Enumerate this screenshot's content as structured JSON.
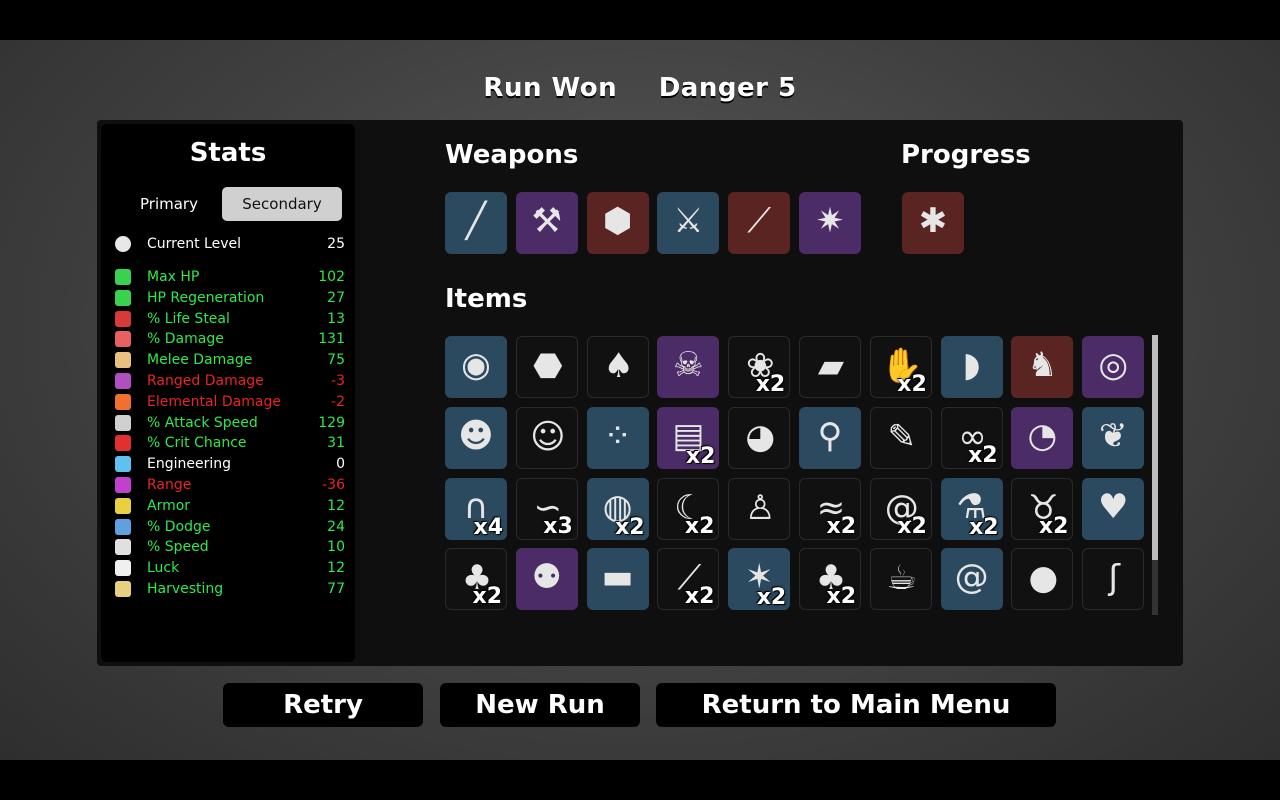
{
  "header": {
    "result": "Run Won",
    "danger": "Danger 5"
  },
  "stats": {
    "title": "Stats",
    "tabs": {
      "primary": "Primary",
      "secondary": "Secondary"
    },
    "current_level": {
      "label": "Current Level",
      "value": "25",
      "icon": "current-level-icon"
    },
    "rows": [
      {
        "label": "Max HP",
        "value": "102",
        "tone": "green",
        "icon": "heart-icon",
        "color": "#3ad14f"
      },
      {
        "label": "HP Regeneration",
        "value": "27",
        "tone": "green",
        "icon": "heart-plus-icon",
        "color": "#3ad14f"
      },
      {
        "label": "% Life Steal",
        "value": "13",
        "tone": "green",
        "icon": "fangs-icon",
        "color": "#d83a3a"
      },
      {
        "label": "% Damage",
        "value": "131",
        "tone": "green",
        "icon": "muscle-icon",
        "color": "#e86060"
      },
      {
        "label": "Melee Damage",
        "value": "75",
        "tone": "green",
        "icon": "sword-icon",
        "color": "#e8c080"
      },
      {
        "label": "Ranged Damage",
        "value": "-3",
        "tone": "red",
        "icon": "bow-icon",
        "color": "#b050c0"
      },
      {
        "label": "Elemental Damage",
        "value": "-2",
        "tone": "red",
        "icon": "fire-icon",
        "color": "#f07030"
      },
      {
        "label": "% Attack Speed",
        "value": "129",
        "tone": "green",
        "icon": "hourglass-icon",
        "color": "#d0d0d0"
      },
      {
        "label": "% Crit Chance",
        "value": "31",
        "tone": "green",
        "icon": "crit-icon",
        "color": "#e03030"
      },
      {
        "label": "Engineering",
        "value": "0",
        "tone": "white",
        "icon": "wrench-icon",
        "color": "#60c0f0"
      },
      {
        "label": "Range",
        "value": "-36",
        "tone": "red",
        "icon": "range-icon",
        "color": "#c040d0"
      },
      {
        "label": "Armor",
        "value": "12",
        "tone": "green",
        "icon": "shield-icon",
        "color": "#e8d040"
      },
      {
        "label": "% Dodge",
        "value": "24",
        "tone": "green",
        "icon": "dodge-icon",
        "color": "#60a0e0"
      },
      {
        "label": "% Speed",
        "value": "10",
        "tone": "green",
        "icon": "boot-icon",
        "color": "#e0e0e0"
      },
      {
        "label": "Luck",
        "value": "12",
        "tone": "green",
        "icon": "dice-icon",
        "color": "#f0f0f0"
      },
      {
        "label": "Harvesting",
        "value": "77",
        "tone": "green",
        "icon": "wheat-icon",
        "color": "#e8d080"
      }
    ]
  },
  "weapons": {
    "title": "Weapons",
    "slots": [
      {
        "name": "spear-icon",
        "tier": "blue",
        "glyph": "╱"
      },
      {
        "name": "axe-icon",
        "tier": "purple",
        "glyph": "⚒"
      },
      {
        "name": "rock-icon",
        "tier": "red",
        "glyph": "⬢"
      },
      {
        "name": "hatchet-icon",
        "tier": "blue",
        "glyph": "⚔"
      },
      {
        "name": "stick-icon",
        "tier": "red",
        "glyph": "⟋"
      },
      {
        "name": "spiked-club-icon",
        "tier": "purple",
        "glyph": "✷"
      }
    ]
  },
  "progress": {
    "title": "Progress",
    "slots": [
      {
        "name": "spider-icon",
        "tier": "red",
        "glyph": "✱"
      }
    ]
  },
  "items": {
    "title": "Items",
    "slots": [
      {
        "name": "egg-face-icon",
        "tier": "blue",
        "glyph": "◉",
        "count": ""
      },
      {
        "name": "coal-icon",
        "tier": "black",
        "glyph": "⬣",
        "count": ""
      },
      {
        "name": "mushroom-icon",
        "tier": "black",
        "glyph": "♠",
        "count": ""
      },
      {
        "name": "skulls-icon",
        "tier": "purple",
        "glyph": "☠",
        "count": ""
      },
      {
        "name": "butterfly-icon",
        "tier": "black",
        "glyph": "❀",
        "count": "x2"
      },
      {
        "name": "cake-icon",
        "tier": "black",
        "glyph": "▰",
        "count": ""
      },
      {
        "name": "claw-icon",
        "tier": "black",
        "glyph": "✋",
        "count": "x2"
      },
      {
        "name": "horn-icon",
        "tier": "blue",
        "glyph": "◗",
        "count": ""
      },
      {
        "name": "mammoth-icon",
        "tier": "red",
        "glyph": "♞",
        "count": ""
      },
      {
        "name": "alien-eye-icon",
        "tier": "purple",
        "glyph": "◎",
        "count": ""
      },
      {
        "name": "mummy-icon",
        "tier": "blue",
        "glyph": "☻",
        "count": ""
      },
      {
        "name": "monkey-icon",
        "tier": "black",
        "glyph": "☺",
        "count": ""
      },
      {
        "name": "bloody-balls-icon",
        "tier": "blue",
        "glyph": "⁘",
        "count": ""
      },
      {
        "name": "scroll-icon",
        "tier": "purple",
        "glyph": "▤",
        "count": "x2"
      },
      {
        "name": "duck-icon",
        "tier": "black",
        "glyph": "◕",
        "count": ""
      },
      {
        "name": "bone-key-icon",
        "tier": "blue",
        "glyph": "⚲",
        "count": ""
      },
      {
        "name": "syringe-icon",
        "tier": "black",
        "glyph": "✎",
        "count": ""
      },
      {
        "name": "goggles-icon",
        "tier": "black",
        "glyph": "∞",
        "count": "x2"
      },
      {
        "name": "mouse-icon",
        "tier": "purple",
        "glyph": "◔",
        "count": ""
      },
      {
        "name": "bunny-icon",
        "tier": "blue",
        "glyph": "❦",
        "count": ""
      },
      {
        "name": "sausage-icon",
        "tier": "blue",
        "glyph": "∩",
        "count": "x4"
      },
      {
        "name": "worm-icon",
        "tier": "black",
        "glyph": "∽",
        "count": "x3"
      },
      {
        "name": "belt-icon",
        "tier": "blue",
        "glyph": "◍",
        "count": "x2"
      },
      {
        "name": "tooth-icon",
        "tier": "black",
        "glyph": "☾",
        "count": "x2"
      },
      {
        "name": "ghost-icon",
        "tier": "black",
        "glyph": "♙",
        "count": ""
      },
      {
        "name": "lizard-icon",
        "tier": "black",
        "glyph": "≈",
        "count": "x2"
      },
      {
        "name": "ram-horn-icon",
        "tier": "black",
        "glyph": "@",
        "count": "x2"
      },
      {
        "name": "potion-icon",
        "tier": "blue",
        "glyph": "⚗",
        "count": "x2"
      },
      {
        "name": "goat-skull-icon",
        "tier": "black",
        "glyph": "♉",
        "count": "x2"
      },
      {
        "name": "piggy-bank-icon",
        "tier": "blue",
        "glyph": "♥",
        "count": ""
      },
      {
        "name": "bat-icon",
        "tier": "black",
        "glyph": "♣",
        "count": "x2"
      },
      {
        "name": "robot-bee-icon",
        "tier": "purple",
        "glyph": "⚉",
        "count": ""
      },
      {
        "name": "sunglasses-icon",
        "tier": "blue",
        "glyph": "▬",
        "count": ""
      },
      {
        "name": "knife-icon",
        "tier": "black",
        "glyph": "⟋",
        "count": "x2"
      },
      {
        "name": "claw-slash-icon",
        "tier": "blue",
        "glyph": "✶",
        "count": "x2"
      },
      {
        "name": "cactus-icon",
        "tier": "black",
        "glyph": "♣",
        "count": "x2"
      },
      {
        "name": "coffee-cup-icon",
        "tier": "black",
        "glyph": "☕",
        "count": ""
      },
      {
        "name": "snail-icon",
        "tier": "blue",
        "glyph": "@",
        "count": ""
      },
      {
        "name": "boxing-glove-icon",
        "tier": "black",
        "glyph": "●",
        "count": ""
      },
      {
        "name": "tentacle-icon",
        "tier": "black",
        "glyph": "ʃ",
        "count": ""
      }
    ]
  },
  "buttons": {
    "retry": "Retry",
    "new_run": "New Run",
    "main_menu": "Return to Main Menu"
  }
}
